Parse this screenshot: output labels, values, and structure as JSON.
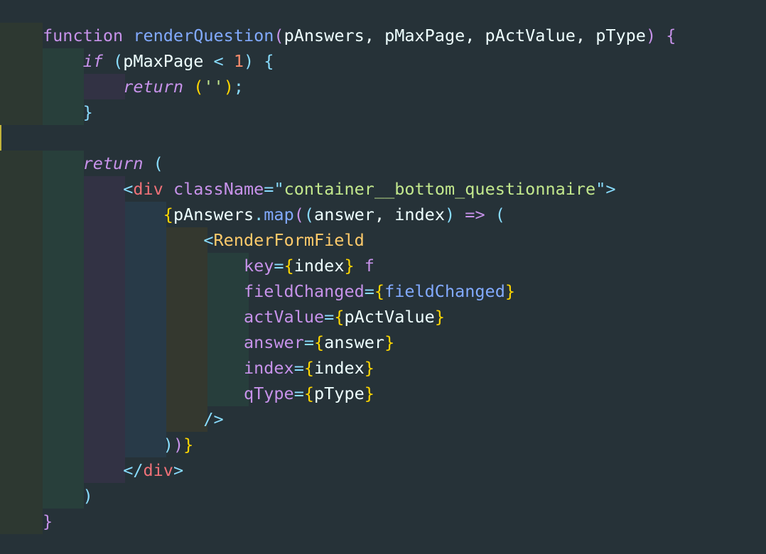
{
  "editor": {
    "theme_colors": {
      "background": "#263238",
      "keyword": "#c792ea",
      "function": "#82aaff",
      "string": "#c3e88d",
      "tag": "#f07178",
      "component": "#ffcb6b",
      "number": "#f78c6c",
      "bracket_gold": "#ffd700",
      "punctuation": "#89ddff"
    },
    "lines": [
      {
        "tokens": [
          {
            "t": "function",
            "c": "kw"
          },
          {
            "t": " ",
            "c": "txt"
          },
          {
            "t": "renderQuestion",
            "c": "fn"
          },
          {
            "t": "(",
            "c": "br1"
          },
          {
            "t": "pAnswers",
            "c": "par"
          },
          {
            "t": ", ",
            "c": "txt"
          },
          {
            "t": "pMaxPage",
            "c": "par"
          },
          {
            "t": ", ",
            "c": "txt"
          },
          {
            "t": "pActValue",
            "c": "par"
          },
          {
            "t": ", ",
            "c": "txt"
          },
          {
            "t": "pType",
            "c": "par"
          },
          {
            "t": ")",
            "c": "br1"
          },
          {
            "t": " ",
            "c": "txt"
          },
          {
            "t": "{",
            "c": "br1"
          }
        ]
      },
      {
        "tokens": [
          {
            "t": "    ",
            "c": "txt"
          },
          {
            "t": "if",
            "c": "kwi"
          },
          {
            "t": " ",
            "c": "txt"
          },
          {
            "t": "(",
            "c": "br2"
          },
          {
            "t": "pMaxPage",
            "c": "par"
          },
          {
            "t": " ",
            "c": "txt"
          },
          {
            "t": "<",
            "c": "pun"
          },
          {
            "t": " ",
            "c": "txt"
          },
          {
            "t": "1",
            "c": "num"
          },
          {
            "t": ")",
            "c": "br2"
          },
          {
            "t": " ",
            "c": "txt"
          },
          {
            "t": "{",
            "c": "br2"
          }
        ]
      },
      {
        "tokens": [
          {
            "t": "        ",
            "c": "txt"
          },
          {
            "t": "return",
            "c": "kwi"
          },
          {
            "t": " ",
            "c": "txt"
          },
          {
            "t": "(",
            "c": "br3"
          },
          {
            "t": "''",
            "c": "str"
          },
          {
            "t": ")",
            "c": "br3"
          },
          {
            "t": ";",
            "c": "pun"
          }
        ]
      },
      {
        "tokens": [
          {
            "t": "    ",
            "c": "txt"
          },
          {
            "t": "}",
            "c": "br2"
          }
        ]
      },
      {
        "tokens": []
      },
      {
        "tokens": [
          {
            "t": "    ",
            "c": "txt"
          },
          {
            "t": "return",
            "c": "kwi"
          },
          {
            "t": " ",
            "c": "txt"
          },
          {
            "t": "(",
            "c": "br2"
          }
        ]
      },
      {
        "tokens": [
          {
            "t": "        ",
            "c": "txt"
          },
          {
            "t": "<",
            "c": "pun"
          },
          {
            "t": "div",
            "c": "tag"
          },
          {
            "t": " ",
            "c": "txt"
          },
          {
            "t": "className",
            "c": "attr"
          },
          {
            "t": "=",
            "c": "pun"
          },
          {
            "t": "\"",
            "c": "pun"
          },
          {
            "t": "container__bottom_questionnaire",
            "c": "str"
          },
          {
            "t": "\"",
            "c": "pun"
          },
          {
            "t": ">",
            "c": "pun"
          }
        ]
      },
      {
        "tokens": [
          {
            "t": "            ",
            "c": "txt"
          },
          {
            "t": "{",
            "c": "br3"
          },
          {
            "t": "pAnswers",
            "c": "txt"
          },
          {
            "t": ".",
            "c": "pun"
          },
          {
            "t": "map",
            "c": "prop"
          },
          {
            "t": "(",
            "c": "br1"
          },
          {
            "t": "(",
            "c": "br2"
          },
          {
            "t": "answer",
            "c": "par"
          },
          {
            "t": ", ",
            "c": "txt"
          },
          {
            "t": "index",
            "c": "par"
          },
          {
            "t": ")",
            "c": "br2"
          },
          {
            "t": " ",
            "c": "txt"
          },
          {
            "t": "=>",
            "c": "kw"
          },
          {
            "t": " ",
            "c": "txt"
          },
          {
            "t": "(",
            "c": "br2"
          }
        ]
      },
      {
        "tokens": [
          {
            "t": "                ",
            "c": "txt"
          },
          {
            "t": "<",
            "c": "pun"
          },
          {
            "t": "RenderFormField",
            "c": "cmp"
          }
        ]
      },
      {
        "tokens": [
          {
            "t": "                    ",
            "c": "txt"
          },
          {
            "t": "key",
            "c": "attr"
          },
          {
            "t": "=",
            "c": "pun"
          },
          {
            "t": "{",
            "c": "br3"
          },
          {
            "t": "index",
            "c": "txt"
          },
          {
            "t": "}",
            "c": "br3"
          },
          {
            "t": " ",
            "c": "txt"
          },
          {
            "t": "f",
            "c": "attr"
          }
        ]
      },
      {
        "tokens": [
          {
            "t": "                    ",
            "c": "txt"
          },
          {
            "t": "fieldChanged",
            "c": "attr"
          },
          {
            "t": "=",
            "c": "pun"
          },
          {
            "t": "{",
            "c": "br3"
          },
          {
            "t": "fieldChanged",
            "c": "prop"
          },
          {
            "t": "}",
            "c": "br3"
          }
        ]
      },
      {
        "tokens": [
          {
            "t": "                    ",
            "c": "txt"
          },
          {
            "t": "actValue",
            "c": "attr"
          },
          {
            "t": "=",
            "c": "pun"
          },
          {
            "t": "{",
            "c": "br3"
          },
          {
            "t": "pActValue",
            "c": "txt"
          },
          {
            "t": "}",
            "c": "br3"
          }
        ]
      },
      {
        "tokens": [
          {
            "t": "                    ",
            "c": "txt"
          },
          {
            "t": "answer",
            "c": "attr"
          },
          {
            "t": "=",
            "c": "pun"
          },
          {
            "t": "{",
            "c": "br3"
          },
          {
            "t": "answer",
            "c": "txt"
          },
          {
            "t": "}",
            "c": "br3"
          }
        ]
      },
      {
        "tokens": [
          {
            "t": "                    ",
            "c": "txt"
          },
          {
            "t": "index",
            "c": "attr"
          },
          {
            "t": "=",
            "c": "pun"
          },
          {
            "t": "{",
            "c": "br3"
          },
          {
            "t": "index",
            "c": "txt"
          },
          {
            "t": "}",
            "c": "br3"
          }
        ]
      },
      {
        "tokens": [
          {
            "t": "                    ",
            "c": "txt"
          },
          {
            "t": "qType",
            "c": "attr"
          },
          {
            "t": "=",
            "c": "pun"
          },
          {
            "t": "{",
            "c": "br3"
          },
          {
            "t": "pType",
            "c": "txt"
          },
          {
            "t": "}",
            "c": "br3"
          }
        ]
      },
      {
        "tokens": [
          {
            "t": "                ",
            "c": "txt"
          },
          {
            "t": "/>",
            "c": "pun"
          }
        ]
      },
      {
        "tokens": [
          {
            "t": "            ",
            "c": "txt"
          },
          {
            "t": ")",
            "c": "br2"
          },
          {
            "t": ")",
            "c": "br1"
          },
          {
            "t": "}",
            "c": "br3"
          }
        ]
      },
      {
        "tokens": [
          {
            "t": "        ",
            "c": "txt"
          },
          {
            "t": "</",
            "c": "pun"
          },
          {
            "t": "div",
            "c": "tag"
          },
          {
            "t": ">",
            "c": "pun"
          }
        ]
      },
      {
        "tokens": [
          {
            "t": "    ",
            "c": "txt"
          },
          {
            "t": ")",
            "c": "br2"
          }
        ]
      },
      {
        "tokens": [
          {
            "t": "}",
            "c": "br1"
          }
        ]
      }
    ]
  }
}
